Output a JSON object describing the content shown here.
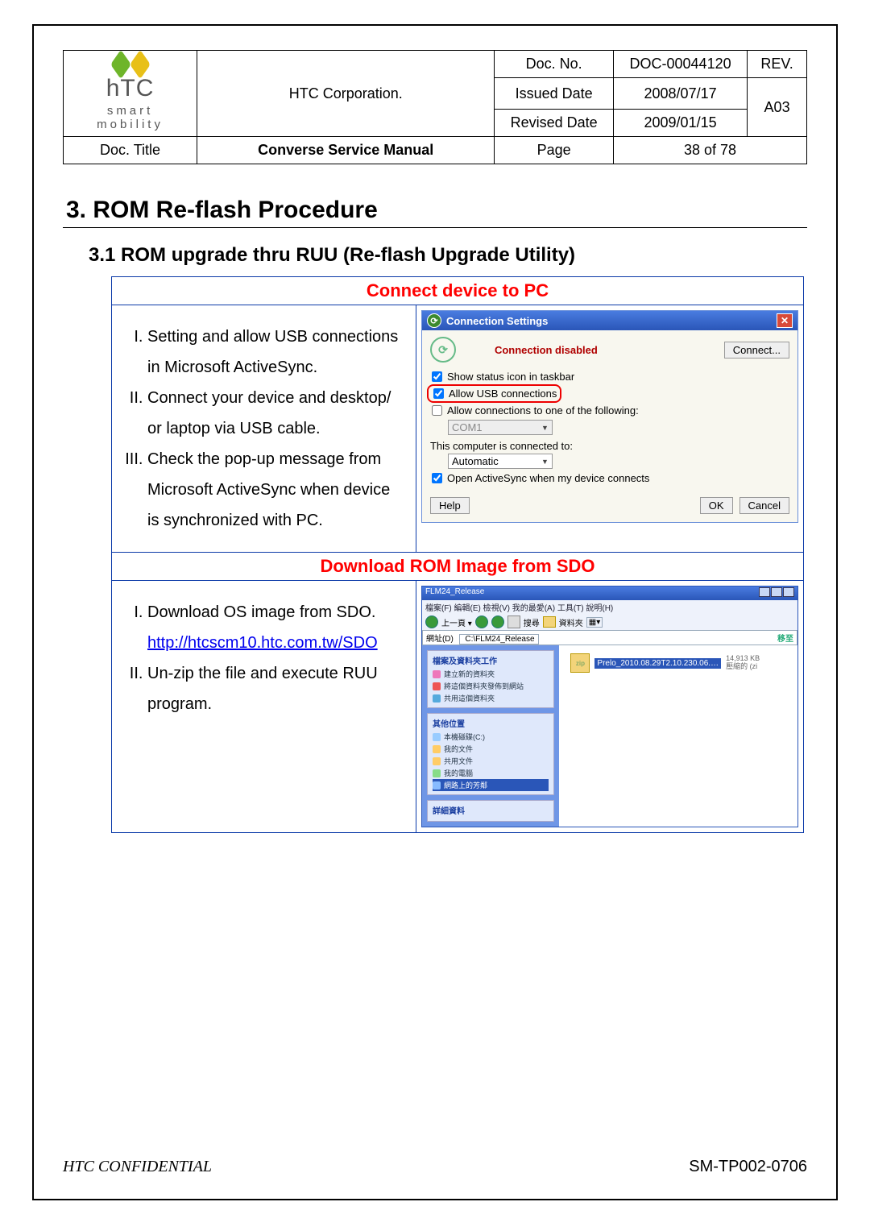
{
  "header": {
    "corp": "HTC Corporation.",
    "logo_line1": "hTC",
    "logo_line2": "smart mobility",
    "doc_no_label": "Doc. No.",
    "doc_no": "DOC-00044120",
    "rev_label": "REV.",
    "rev": "A03",
    "issued_label": "Issued Date",
    "issued": "2008/07/17",
    "revised_label": "Revised Date",
    "revised": "2009/01/15",
    "doc_title_label": "Doc. Title",
    "doc_title": "Converse Service Manual",
    "page_label": "Page",
    "page_value": "38 of 78"
  },
  "h1": "3. ROM Re-flash Procedure",
  "h2": "3.1 ROM upgrade thru RUU (Re-flash Upgrade Utility)",
  "section1": {
    "title": "Connect device to PC",
    "steps": [
      "Setting and allow USB connections in Microsoft ActiveSync.",
      "Connect your device and desktop/ or laptop via USB cable.",
      "Check the pop-up message from Microsoft ActiveSync when device is synchronized with PC."
    ],
    "dialog": {
      "title": "Connection Settings",
      "status": "Connection disabled",
      "connect_btn": "Connect...",
      "chk_status": "Show status icon in taskbar",
      "chk_usb": "Allow USB connections",
      "chk_com": "Allow connections to one of the following:",
      "com_val": "COM1",
      "conn_to": "This computer is connected to:",
      "conn_val": "Automatic",
      "chk_open": "Open ActiveSync when my device connects",
      "help": "Help",
      "ok": "OK",
      "cancel": "Cancel"
    }
  },
  "section2": {
    "title": "Download ROM Image from SDO",
    "steps": [
      "Download OS image from SDO.",
      "Un-zip the file and execute RUU program."
    ],
    "link_text": "http://htcscm10.htc.com.tw/SDO",
    "win": {
      "title": "FLM24_Release",
      "menu": "檔案(F)  編輯(E)  檢視(V)  我的最愛(A)  工具(T)  說明(H)",
      "addr_label": "網址(D)",
      "addr_val": "C:\\FLM24_Release",
      "go": "移至",
      "side_pane1": "檔案及資料夾工作",
      "side_items1": [
        "建立新的資料夾",
        "將這個資料夾發佈到網站",
        "共用這個資料夾"
      ],
      "side_pane2": "其他位置",
      "side_items2": [
        "本機磁碟(C:)",
        "我的文件",
        "共用文件",
        "我的電腦",
        "網路上的芳鄰"
      ],
      "side_pane3": "詳細資料",
      "file_name": "Prelo_2010.08.29T2.10.230.06.…",
      "file_meta1": "14,913 KB",
      "file_meta2": "壓縮的 (zi"
    }
  },
  "footer": {
    "left": "HTC CONFIDENTIAL",
    "right": "SM-TP002-0706"
  }
}
